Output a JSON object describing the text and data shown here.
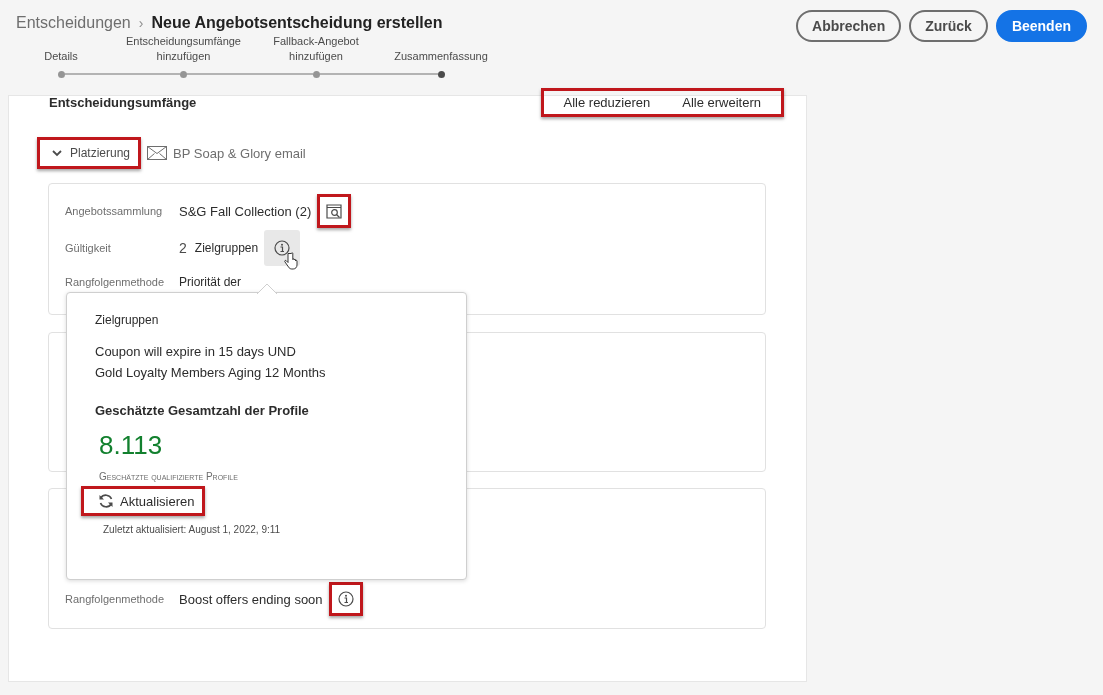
{
  "breadcrumb": {
    "parent": "Entscheidungen",
    "separator": "›",
    "title": "Neue Angebotsentscheidung erstellen"
  },
  "buttons": [
    {
      "label": "Abbrechen",
      "kind": "secondary"
    },
    {
      "label": "Zurück",
      "kind": "secondary"
    },
    {
      "label": "Beenden",
      "kind": "primary"
    }
  ],
  "steps": [
    {
      "label": "Details",
      "selected": false
    },
    {
      "label": "Entscheidungsumfänge hinzufügen",
      "selected": false
    },
    {
      "label": "Fallback-Angebot hinzufügen",
      "selected": false
    },
    {
      "label": "Zusammenfassung",
      "selected": true
    }
  ],
  "section": {
    "title": "Entscheidungsumfänge",
    "actions": {
      "items": [
        "Alle reduzieren",
        "Alle erweitern"
      ],
      "highlighted": true
    }
  },
  "placement": {
    "label": "Platzierung",
    "expanded": true,
    "highlighted": true,
    "channel": "BP Soap & Glory email"
  },
  "cards": [
    {
      "kind": "details",
      "rows": [
        {
          "label": "Angebotssammlung",
          "value": "S&G Fall Collection (2)",
          "kind": "collection",
          "highlighted": true
        },
        {
          "label": "Gültigkeit",
          "count": "2",
          "value": "Zielgruppen",
          "kind": "audience",
          "hovered": true
        },
        {
          "label": "Rangfolgenmethode",
          "value": "Priorität der",
          "kind": "text"
        }
      ]
    },
    {
      "kind": "empty"
    },
    {
      "kind": "details",
      "rows": [
        {
          "label": "Rangfolgenmethode",
          "value": "Boost offers ending soon",
          "kind": "info",
          "highlighted": true
        }
      ]
    }
  ],
  "popover": {
    "title": "Zielgruppen",
    "lines": [
      "Coupon will expire in 15 days UND",
      "Gold Loyalty Members Aging 12 Months"
    ],
    "heading": "Geschätzte Gesamtzahl der Profile",
    "count": "8.113",
    "count_label": "Geschätzte qualifizierte Profile",
    "refresh": {
      "label": "Aktualisieren",
      "highlighted": true
    },
    "updated": "Zuletzt aktualisiert: August 1, 2022, 9:11"
  }
}
